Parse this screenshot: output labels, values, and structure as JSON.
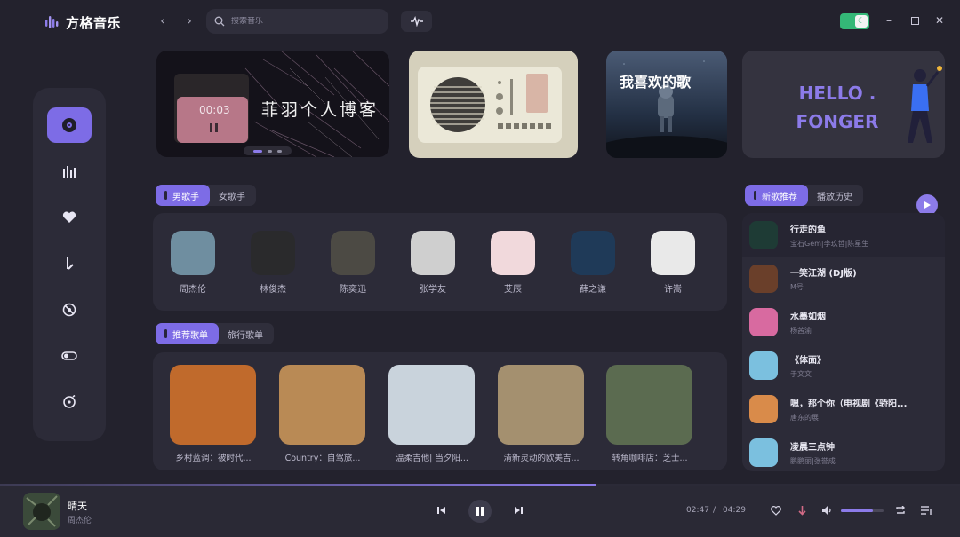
{
  "app": {
    "name": "方格音乐",
    "logo_icon": "waveform-logo-icon"
  },
  "search": {
    "placeholder": "搜索音乐"
  },
  "banners": {
    "b1_title": "菲羽个人博客",
    "b1_timer": "00:03",
    "b3_title": "我喜欢的歌",
    "b4_title_line1": "HELLO .",
    "b4_title_line2": "FONGER"
  },
  "singer_tabs": [
    {
      "label": "男歌手"
    },
    {
      "label": "女歌手"
    }
  ],
  "singers": [
    {
      "name": "周杰伦",
      "color": "#6f8ea0"
    },
    {
      "name": "林俊杰",
      "color": "#2a2a2c"
    },
    {
      "name": "陈奕迅",
      "color": "#4c4a44"
    },
    {
      "name": "张学友",
      "color": "#cfcfcf"
    },
    {
      "name": "艾辰",
      "color": "#f1d9dc"
    },
    {
      "name": "薛之谦",
      "color": "#1f3a58"
    },
    {
      "name": "许嵩",
      "color": "#e9e9e9"
    }
  ],
  "list_tabs": [
    {
      "label": "推荐歌单"
    },
    {
      "label": "旅行歌单"
    }
  ],
  "playlists": [
    {
      "title": "乡村蓝调：被时代...",
      "color": "#c06a2c"
    },
    {
      "title": "Country：自驾旅...",
      "color": "#b98a55"
    },
    {
      "title": "温柔吉他| 当夕阳...",
      "color": "#c9d3dc"
    },
    {
      "title": "清新灵动的欧美吉...",
      "color": "#a4906f"
    },
    {
      "title": "转角咖啡店：芝士...",
      "color": "#5b6b50"
    }
  ],
  "right_tabs": [
    {
      "label": "新歌推荐"
    },
    {
      "label": "播放历史"
    }
  ],
  "songs": [
    {
      "title": "行走的鱼",
      "artist": "宝石Gem|李玖哲|陈星生",
      "color": "#1e3b35"
    },
    {
      "title": "一笑江湖 (DJ版)",
      "artist": "M号",
      "color": "#6a3f2a"
    },
    {
      "title": "水墨如烟",
      "artist": "杨茜渝",
      "color": "#d86aa0"
    },
    {
      "title": "《体面》",
      "artist": "于文文",
      "color": "#7bc0df"
    },
    {
      "title": "嗯，那个你（电视剧《骄阳...",
      "artist": "唐东的展",
      "color": "#d98b4a"
    },
    {
      "title": "凌晨三点钟",
      "artist": "鹏鹏丽|张誉成",
      "color": "#7bc0df"
    }
  ],
  "player": {
    "title": "晴天",
    "artist": "周杰伦",
    "current_time": "02:47",
    "separator": "/",
    "total_time": "04:29",
    "progress": 0.62,
    "volume": 0.75
  },
  "colors": {
    "accent": "#7d6ce6",
    "background": "#23222d",
    "panel": "#2c2b38",
    "toggle_green": "#34b877"
  }
}
